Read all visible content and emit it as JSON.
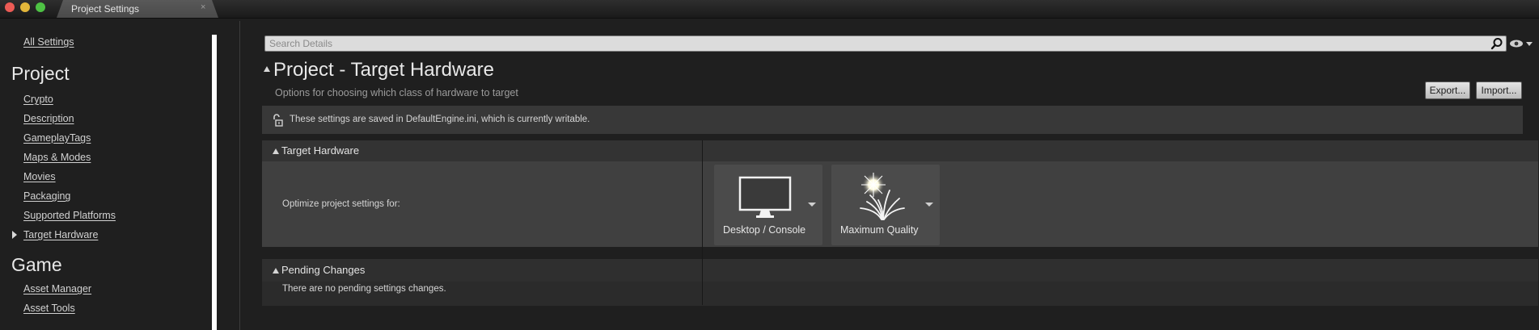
{
  "window": {
    "tab_title": "Project Settings",
    "tab_close_glyph": "×"
  },
  "sidebar": {
    "top_link": "All Settings",
    "groups": [
      {
        "heading": "Project",
        "items": [
          {
            "label": "Crypto"
          },
          {
            "label": "Description"
          },
          {
            "label": "GameplayTags"
          },
          {
            "label": "Maps & Modes"
          },
          {
            "label": "Movies"
          },
          {
            "label": "Packaging"
          },
          {
            "label": "Supported Platforms"
          },
          {
            "label": "Target Hardware",
            "selected": true,
            "icon": "expand-arrow-icon"
          }
        ]
      },
      {
        "heading": "Game",
        "items": [
          {
            "label": "Asset Manager"
          },
          {
            "label": "Asset Tools"
          }
        ]
      }
    ]
  },
  "search": {
    "placeholder": "Search Details",
    "icon": "search-icon"
  },
  "view_options_icon": "eye-icon",
  "header": {
    "title": "Project - Target Hardware",
    "subtitle": "Options for choosing which class of hardware to target",
    "export_label": "Export...",
    "import_label": "Import..."
  },
  "notice": {
    "icon": "unlock-icon",
    "text": "These settings are saved in DefaultEngine.ini, which is currently writable."
  },
  "target_hardware": {
    "section_label": "Target Hardware",
    "row_label": "Optimize project settings for:",
    "platform": {
      "label": "Desktop / Console",
      "icon": "monitor-icon"
    },
    "quality": {
      "label": "Maximum Quality",
      "icon": "grass-sun-icon"
    }
  },
  "pending_changes": {
    "section_label": "Pending Changes",
    "text": "There are no pending settings changes."
  },
  "colors": {
    "background": "#1f1f1f",
    "row_background": "#404040",
    "tile_background": "#4b4b4b",
    "close": "#ec5b55",
    "minimize": "#e3b63a",
    "maximize": "#4ec244"
  }
}
